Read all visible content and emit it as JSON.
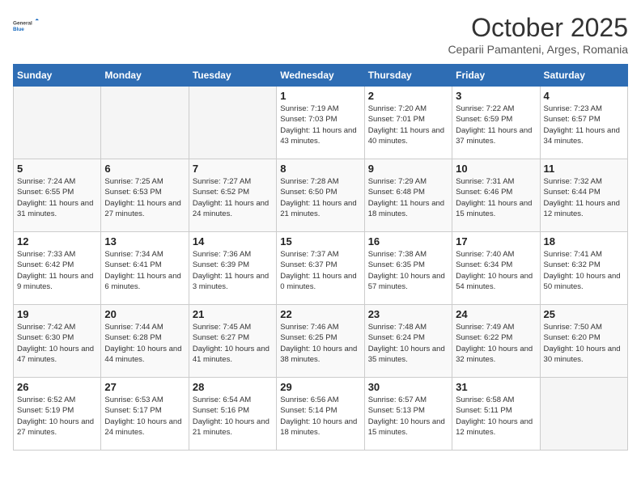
{
  "header": {
    "logo_line1": "General",
    "logo_line2": "Blue",
    "month": "October 2025",
    "location": "Ceparii Pamanteni, Arges, Romania"
  },
  "weekdays": [
    "Sunday",
    "Monday",
    "Tuesday",
    "Wednesday",
    "Thursday",
    "Friday",
    "Saturday"
  ],
  "weeks": [
    [
      {
        "day": "",
        "empty": true
      },
      {
        "day": "",
        "empty": true
      },
      {
        "day": "",
        "empty": true
      },
      {
        "day": "1",
        "sunrise": "7:19 AM",
        "sunset": "7:03 PM",
        "daylight": "11 hours and 43 minutes."
      },
      {
        "day": "2",
        "sunrise": "7:20 AM",
        "sunset": "7:01 PM",
        "daylight": "11 hours and 40 minutes."
      },
      {
        "day": "3",
        "sunrise": "7:22 AM",
        "sunset": "6:59 PM",
        "daylight": "11 hours and 37 minutes."
      },
      {
        "day": "4",
        "sunrise": "7:23 AM",
        "sunset": "6:57 PM",
        "daylight": "11 hours and 34 minutes."
      }
    ],
    [
      {
        "day": "5",
        "sunrise": "7:24 AM",
        "sunset": "6:55 PM",
        "daylight": "11 hours and 31 minutes."
      },
      {
        "day": "6",
        "sunrise": "7:25 AM",
        "sunset": "6:53 PM",
        "daylight": "11 hours and 27 minutes."
      },
      {
        "day": "7",
        "sunrise": "7:27 AM",
        "sunset": "6:52 PM",
        "daylight": "11 hours and 24 minutes."
      },
      {
        "day": "8",
        "sunrise": "7:28 AM",
        "sunset": "6:50 PM",
        "daylight": "11 hours and 21 minutes."
      },
      {
        "day": "9",
        "sunrise": "7:29 AM",
        "sunset": "6:48 PM",
        "daylight": "11 hours and 18 minutes."
      },
      {
        "day": "10",
        "sunrise": "7:31 AM",
        "sunset": "6:46 PM",
        "daylight": "11 hours and 15 minutes."
      },
      {
        "day": "11",
        "sunrise": "7:32 AM",
        "sunset": "6:44 PM",
        "daylight": "11 hours and 12 minutes."
      }
    ],
    [
      {
        "day": "12",
        "sunrise": "7:33 AM",
        "sunset": "6:42 PM",
        "daylight": "11 hours and 9 minutes."
      },
      {
        "day": "13",
        "sunrise": "7:34 AM",
        "sunset": "6:41 PM",
        "daylight": "11 hours and 6 minutes."
      },
      {
        "day": "14",
        "sunrise": "7:36 AM",
        "sunset": "6:39 PM",
        "daylight": "11 hours and 3 minutes."
      },
      {
        "day": "15",
        "sunrise": "7:37 AM",
        "sunset": "6:37 PM",
        "daylight": "11 hours and 0 minutes."
      },
      {
        "day": "16",
        "sunrise": "7:38 AM",
        "sunset": "6:35 PM",
        "daylight": "10 hours and 57 minutes."
      },
      {
        "day": "17",
        "sunrise": "7:40 AM",
        "sunset": "6:34 PM",
        "daylight": "10 hours and 54 minutes."
      },
      {
        "day": "18",
        "sunrise": "7:41 AM",
        "sunset": "6:32 PM",
        "daylight": "10 hours and 50 minutes."
      }
    ],
    [
      {
        "day": "19",
        "sunrise": "7:42 AM",
        "sunset": "6:30 PM",
        "daylight": "10 hours and 47 minutes."
      },
      {
        "day": "20",
        "sunrise": "7:44 AM",
        "sunset": "6:28 PM",
        "daylight": "10 hours and 44 minutes."
      },
      {
        "day": "21",
        "sunrise": "7:45 AM",
        "sunset": "6:27 PM",
        "daylight": "10 hours and 41 minutes."
      },
      {
        "day": "22",
        "sunrise": "7:46 AM",
        "sunset": "6:25 PM",
        "daylight": "10 hours and 38 minutes."
      },
      {
        "day": "23",
        "sunrise": "7:48 AM",
        "sunset": "6:24 PM",
        "daylight": "10 hours and 35 minutes."
      },
      {
        "day": "24",
        "sunrise": "7:49 AM",
        "sunset": "6:22 PM",
        "daylight": "10 hours and 32 minutes."
      },
      {
        "day": "25",
        "sunrise": "7:50 AM",
        "sunset": "6:20 PM",
        "daylight": "10 hours and 30 minutes."
      }
    ],
    [
      {
        "day": "26",
        "sunrise": "6:52 AM",
        "sunset": "5:19 PM",
        "daylight": "10 hours and 27 minutes."
      },
      {
        "day": "27",
        "sunrise": "6:53 AM",
        "sunset": "5:17 PM",
        "daylight": "10 hours and 24 minutes."
      },
      {
        "day": "28",
        "sunrise": "6:54 AM",
        "sunset": "5:16 PM",
        "daylight": "10 hours and 21 minutes."
      },
      {
        "day": "29",
        "sunrise": "6:56 AM",
        "sunset": "5:14 PM",
        "daylight": "10 hours and 18 minutes."
      },
      {
        "day": "30",
        "sunrise": "6:57 AM",
        "sunset": "5:13 PM",
        "daylight": "10 hours and 15 minutes."
      },
      {
        "day": "31",
        "sunrise": "6:58 AM",
        "sunset": "5:11 PM",
        "daylight": "10 hours and 12 minutes."
      },
      {
        "day": "",
        "empty": true
      }
    ]
  ]
}
